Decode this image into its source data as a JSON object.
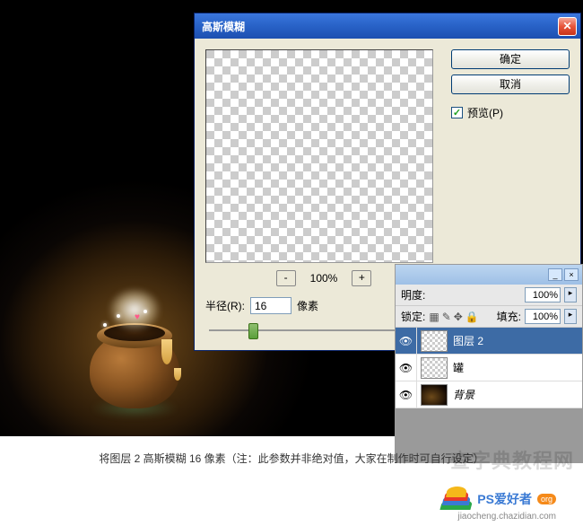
{
  "dialog": {
    "title": "高斯模糊",
    "ok": "确定",
    "cancel": "取消",
    "preview_label": "预览(P)",
    "preview_checked": true,
    "zoom_out": "-",
    "zoom_in": "+",
    "zoom_value": "100%",
    "radius_label": "半径(R):",
    "radius_value": "16",
    "radius_unit": "像素"
  },
  "layers": {
    "opacity_label": "明度:",
    "opacity_value": "100%",
    "lock_label": "锁定:",
    "fill_label": "填充:",
    "fill_value": "100%",
    "items": [
      {
        "name": "图层 2",
        "selected": true,
        "thumb": "checker"
      },
      {
        "name": "罐",
        "selected": false,
        "thumb": "checker"
      },
      {
        "name": "背景",
        "selected": false,
        "thumb": "bg"
      }
    ]
  },
  "caption": "将图层 2 高斯模糊 16 像素（注：此参数并非绝对值，大家在制作时可自行设定）",
  "watermark": "查字典教程网",
  "logo": {
    "text": "PS爱好者",
    "badge": "org",
    "url": "jiaocheng.chazidian.com"
  }
}
